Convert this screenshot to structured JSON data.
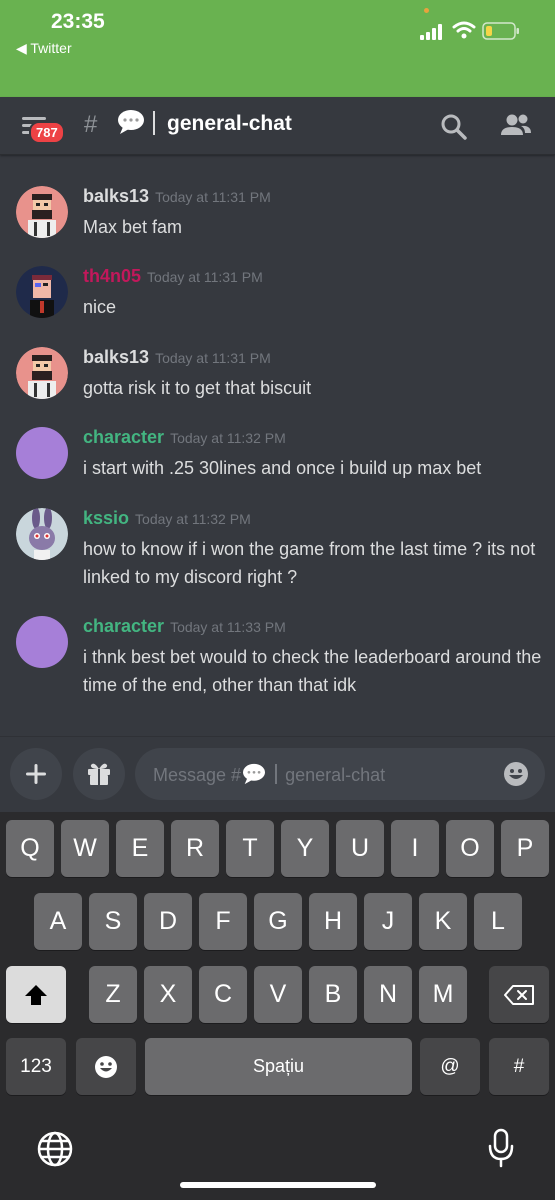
{
  "status_bar": {
    "time": "23:35",
    "back_label": "◀ Twitter"
  },
  "header": {
    "badge": "787",
    "hash": "#",
    "channel": "general-chat"
  },
  "messages": [
    {
      "author": "balks13",
      "time": "Today at 11:31 PM",
      "text": "Max bet fam",
      "color": "#ffffff"
    },
    {
      "author": "th4n05",
      "time": "Today at 11:31 PM",
      "text": "nice",
      "color": "#c2185b"
    },
    {
      "author": "balks13",
      "time": "Today at 11:31 PM",
      "text": "gotta risk it to get that biscuit",
      "color": "#ffffff"
    },
    {
      "author": "character",
      "time": "Today at 11:32 PM",
      "text": "i start with .25 30lines and once i build up max bet",
      "color": "#43b581"
    },
    {
      "author": "kssio",
      "time": "Today at 11:32 PM",
      "text": "how to know if i won the game from the last time ? its not linked to my discord right ?",
      "color": "#43b581"
    },
    {
      "author": "character",
      "time": "Today at 11:33 PM",
      "text": "i thnk best bet would to check the leaderboard around the time of the end, other than that idk",
      "color": "#43b581"
    }
  ],
  "input": {
    "placeholder_prefix": "Message #",
    "placeholder_channel": "general-chat"
  },
  "keyboard": {
    "row1": [
      "Q",
      "W",
      "E",
      "R",
      "T",
      "Y",
      "U",
      "I",
      "O",
      "P"
    ],
    "row2": [
      "A",
      "S",
      "D",
      "F",
      "G",
      "H",
      "J",
      "K",
      "L"
    ],
    "row3": [
      "Z",
      "X",
      "C",
      "V",
      "B",
      "N",
      "M"
    ],
    "numbers_label": "123",
    "space_label": "Spațiu",
    "at_label": "@",
    "hash_label": "#"
  }
}
